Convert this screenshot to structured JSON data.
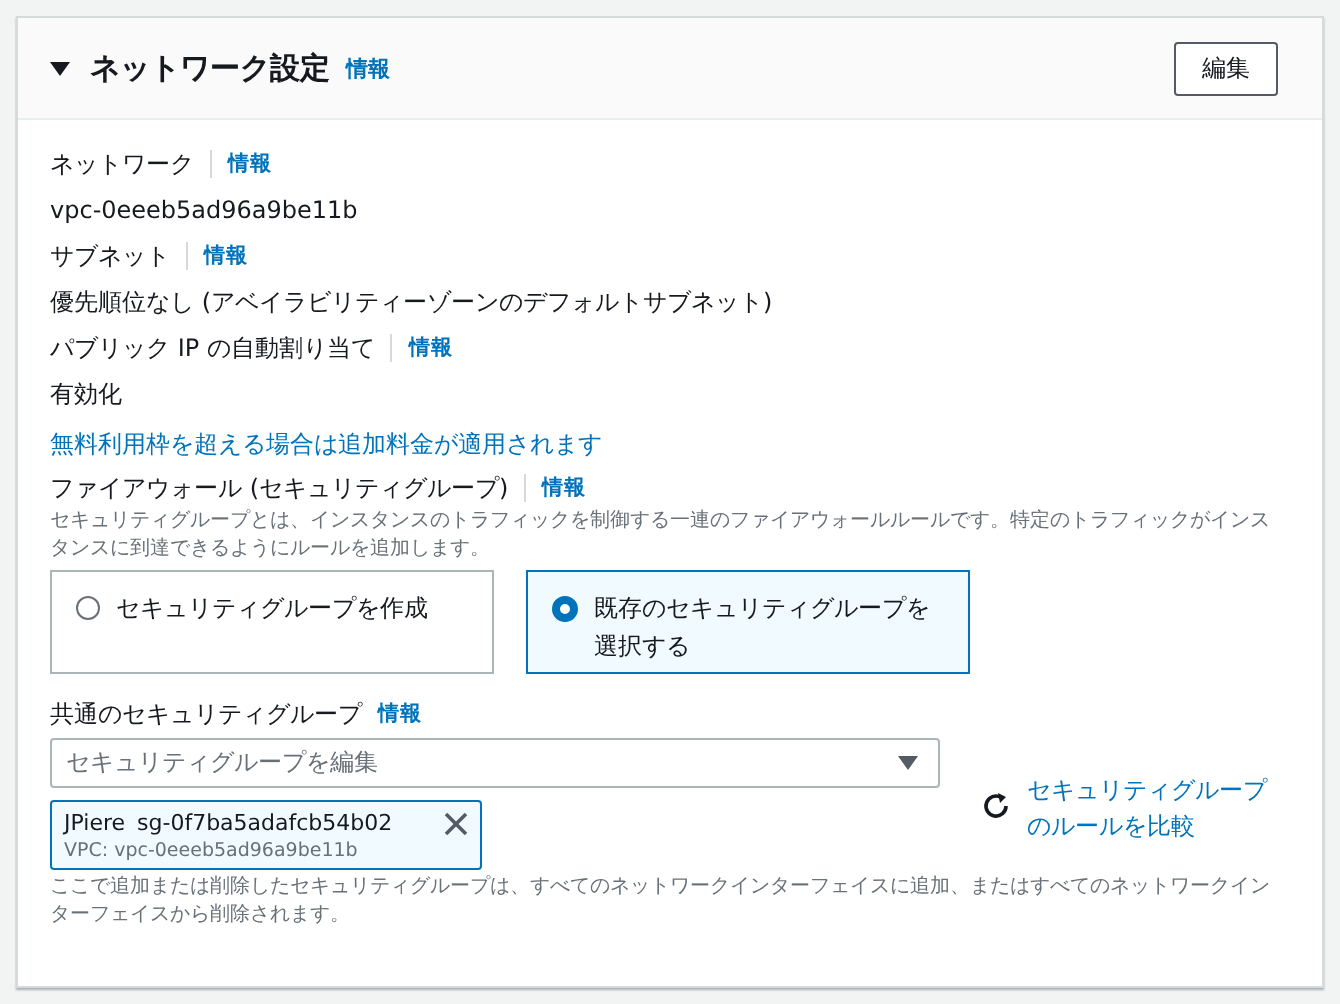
{
  "panel": {
    "title": "ネットワーク設定",
    "expanded": true,
    "info": "情報",
    "edit_button": "編集"
  },
  "fields": [
    {
      "label": "ネットワーク",
      "info": "情報",
      "value": "vpc-0eeeb5ad96a9be11b"
    },
    {
      "label": "サブネット",
      "info": "情報",
      "value": "優先順位なし (アベイラビリティーゾーンのデフォルトサブネット)"
    },
    {
      "label": "パブリック IP の自動割り当て",
      "info": "情報",
      "value": "有効化"
    }
  ],
  "pricing_link": "無料利用枠を超える場合は追加料金が適用されます",
  "firewall": {
    "label": "ファイアウォール (セキュリティグループ)",
    "info": "情報",
    "description": "セキュリティグループとは、インスタンスのトラフィックを制御する一連のファイアウォールルールです。特定のトラフィックがインスタンスに到達できるようにルールを追加します。",
    "options": [
      {
        "label": "セキュリティグループを作成",
        "selected": false
      },
      {
        "label": "既存のセキュリティグループを選択する",
        "selected": true
      }
    ]
  },
  "common_sg": {
    "label": "共通のセキュリティグループ",
    "info": "情報",
    "placeholder": "セキュリティグループを編集",
    "tokens": [
      {
        "name": "JPiere",
        "id": "sg-0f7ba5adafcb54b02",
        "vpc": "VPC: vpc-0eeeb5ad96a9be11b"
      }
    ],
    "compare_link": "セキュリティグループのルールを比較",
    "note": "ここで追加または削除したセキュリティグループは、すべてのネットワークインターフェイスに追加、またはすべてのネットワークインターフェイスから削除されます。"
  }
}
